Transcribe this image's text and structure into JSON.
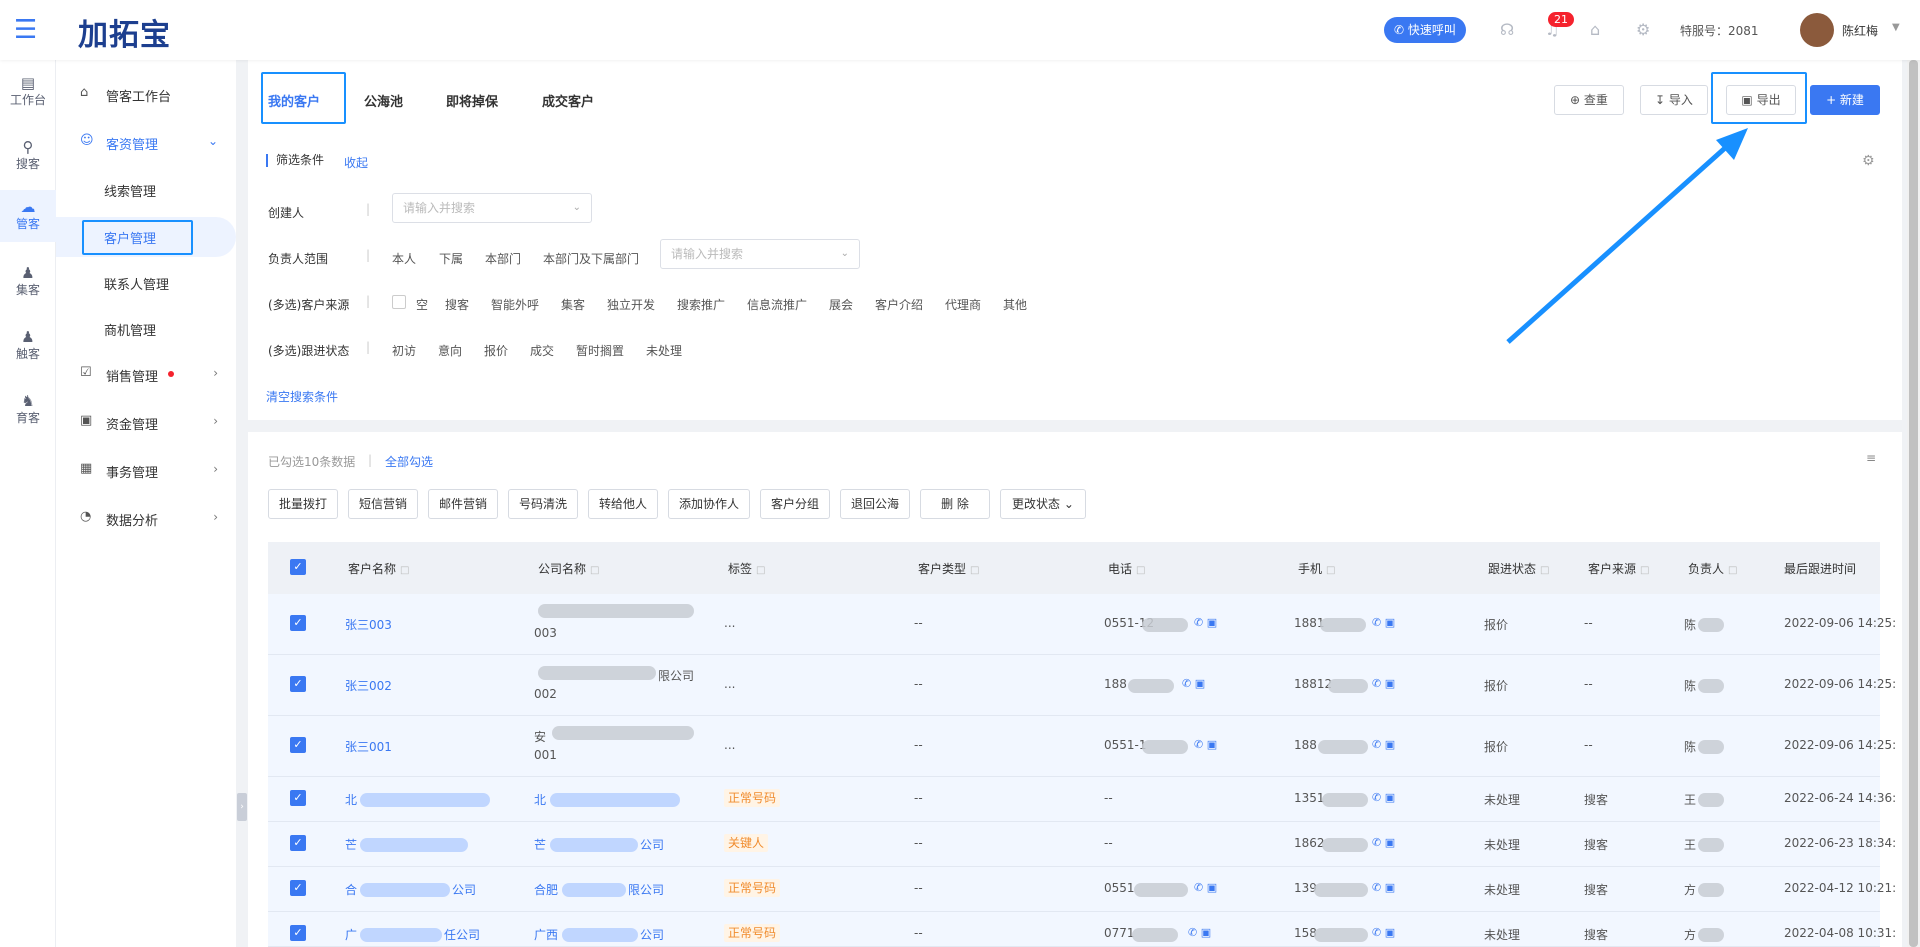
{
  "header": {
    "logo": "加拓宝",
    "quick_call": "快速呼叫",
    "notification_count": "21",
    "service_no": "特服号：2081",
    "user_name": "陈红梅"
  },
  "rail": [
    {
      "label": "工作台",
      "icon": "monitor-icon"
    },
    {
      "label": "搜客",
      "icon": "search-user-icon"
    },
    {
      "label": "管客",
      "icon": "crm-cloud-icon"
    },
    {
      "label": "集客",
      "icon": "group-icon"
    },
    {
      "label": "触客",
      "icon": "contact-icon"
    },
    {
      "label": "育客",
      "icon": "nurture-icon"
    }
  ],
  "sidebar": {
    "items": [
      {
        "label": "管客工作台",
        "icon": "home-icon"
      },
      {
        "label": "客资管理",
        "icon": "user-icon"
      },
      {
        "label": "线索管理"
      },
      {
        "label": "客户管理"
      },
      {
        "label": "联系人管理"
      },
      {
        "label": "商机管理"
      },
      {
        "label": "销售管理",
        "icon": "check-square-icon"
      },
      {
        "label": "资金管理",
        "icon": "wallet-icon"
      },
      {
        "label": "事务管理",
        "icon": "calendar-icon"
      },
      {
        "label": "数据分析",
        "icon": "pie-icon"
      }
    ]
  },
  "tabs": [
    "我的客户",
    "公海池",
    "即将掉保",
    "成交客户"
  ],
  "toolbar": {
    "query": "查重",
    "import": "导入",
    "export": "导出",
    "create": "+ 新建"
  },
  "filter": {
    "title": "筛选条件",
    "collapse": "收起",
    "creator_label": "创建人",
    "creator_placeholder": "请输入并搜索",
    "owner_label": "负责人范围",
    "owner_options": [
      "本人",
      "下属",
      "本部门",
      "本部门及下属部门"
    ],
    "owner_placeholder": "请输入并搜索",
    "source_label": "(多选)客户来源",
    "source_options": [
      "空",
      "搜客",
      "智能外呼",
      "集客",
      "独立开发",
      "搜索推广",
      "信息流推广",
      "展会",
      "客户介绍",
      "代理商",
      "其他"
    ],
    "status_label": "(多选)跟进状态",
    "status_options": [
      "初访",
      "意向",
      "报价",
      "成交",
      "暂时搁置",
      "未处理"
    ],
    "clear": "清空搜索条件"
  },
  "selection": {
    "info": "已勾选10条数据",
    "select_all": "全部勾选"
  },
  "actions": [
    "批量拨打",
    "短信营销",
    "邮件营销",
    "号码清洗",
    "转给他人",
    "添加协作人",
    "客户分组",
    "退回公海",
    "删 除",
    "更改状态"
  ],
  "table": {
    "columns": [
      "客户名称",
      "公司名称",
      "标签",
      "客户类型",
      "电话",
      "手机",
      "跟进状态",
      "客户来源",
      "负责人",
      "最后跟进时间"
    ],
    "rows": [
      {
        "name": "张三003",
        "company": "003",
        "company_tail": "",
        "tag": "...",
        "type": "--",
        "phone": "0551-12",
        "mobile": "1881",
        "status": "报价",
        "source": "--",
        "owner": "陈",
        "time": "2022-09-06 14:25:"
      },
      {
        "name": "张三002",
        "company": "002",
        "company_tail": "限公司",
        "tag": "...",
        "type": "--",
        "phone": "188",
        "mobile": "18812",
        "status": "报价",
        "source": "--",
        "owner": "陈",
        "time": "2022-09-06 14:25:"
      },
      {
        "name": "张三001",
        "company": "001",
        "company_tail": "安",
        "tag": "...",
        "type": "--",
        "phone": "0551-1",
        "mobile": "188",
        "status": "报价",
        "source": "--",
        "owner": "陈",
        "time": "2022-09-06 14:25:"
      },
      {
        "name": "北",
        "company": "北",
        "tag": "正常号码",
        "type": "--",
        "phone": "--",
        "mobile": "1351",
        "status": "未处理",
        "source": "搜客",
        "owner": "王",
        "time": "2022-06-24 14:36:"
      },
      {
        "name": "芒",
        "company": "芒",
        "company_end": "公司",
        "tag": "关键人",
        "type": "--",
        "phone": "--",
        "mobile": "1862",
        "status": "未处理",
        "source": "搜客",
        "owner": "王",
        "time": "2022-06-23 18:34:"
      },
      {
        "name": "合",
        "name_end": "公司",
        "company": "合肥",
        "company_end": "限公司",
        "tag": "正常号码",
        "type": "--",
        "phone": "0551",
        "mobile": "139",
        "status": "未处理",
        "source": "搜客",
        "owner": "方",
        "time": "2022-04-12 10:21:"
      },
      {
        "name": "广",
        "name_end": "任公司",
        "company": "广西",
        "company_end": "公司",
        "tag": "正常号码",
        "type": "--",
        "phone": "0771",
        "mobile": "158",
        "status": "未处理",
        "source": "搜客",
        "owner": "方",
        "time": "2022-04-08 10:31:"
      }
    ]
  }
}
